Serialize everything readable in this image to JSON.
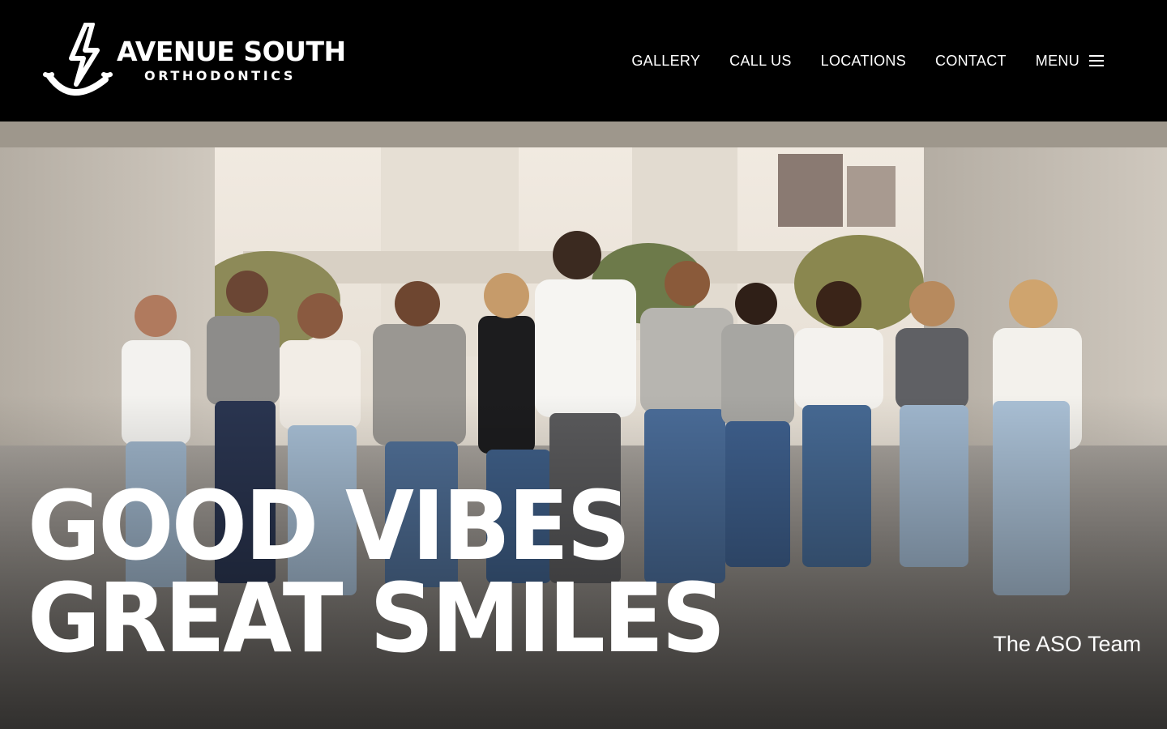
{
  "brand": {
    "name": "AVENUE SOUTH",
    "subtitle": "ORTHODONTICS",
    "logo_icon": "lightning-smile-icon"
  },
  "nav": {
    "items": [
      {
        "label": "GALLERY"
      },
      {
        "label": "CALL US"
      },
      {
        "label": "LOCATIONS"
      },
      {
        "label": "CONTACT"
      }
    ],
    "menu_label": "MENU",
    "menu_icon": "hamburger-icon"
  },
  "hero": {
    "headline_line1": "GOOD VIBES",
    "headline_line2": "GREAT SMILES",
    "caption": "The ASO Team",
    "image": "team-photo"
  },
  "colors": {
    "header_bg": "#000000",
    "text": "#ffffff"
  }
}
